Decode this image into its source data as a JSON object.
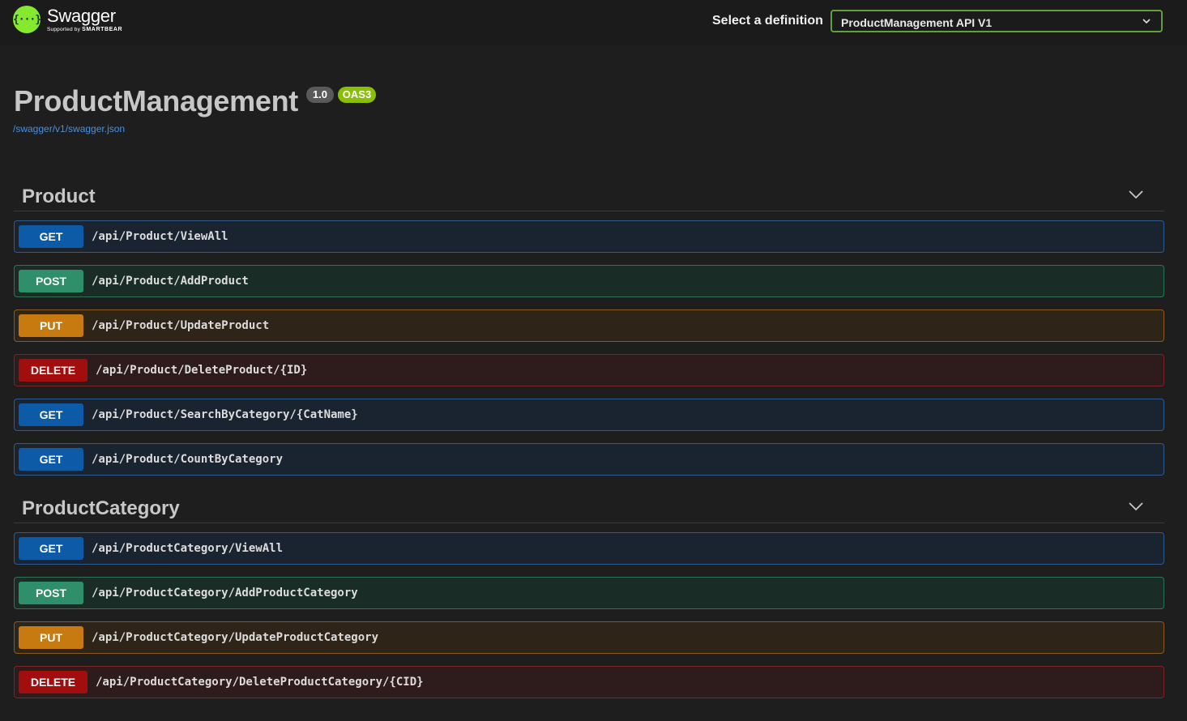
{
  "header": {
    "logo_name": "Swagger",
    "logo_sub_prefix": "Supported by",
    "logo_sub_brand": "SMARTBEAR",
    "select_label": "Select a definition",
    "selected_definition": "ProductManagement API V1"
  },
  "info": {
    "title": "ProductManagement",
    "version": "1.0",
    "oas": "OAS3",
    "spec_url": "/swagger/v1/swagger.json"
  },
  "sections": [
    {
      "name": "Product",
      "operations": [
        {
          "method": "GET",
          "path": "/api/Product/ViewAll"
        },
        {
          "method": "POST",
          "path": "/api/Product/AddProduct"
        },
        {
          "method": "PUT",
          "path": "/api/Product/UpdateProduct"
        },
        {
          "method": "DELETE",
          "path": "/api/Product/DeleteProduct/{ID}"
        },
        {
          "method": "GET",
          "path": "/api/Product/SearchByCategory/{CatName}"
        },
        {
          "method": "GET",
          "path": "/api/Product/CountByCategory"
        }
      ]
    },
    {
      "name": "ProductCategory",
      "operations": [
        {
          "method": "GET",
          "path": "/api/ProductCategory/ViewAll"
        },
        {
          "method": "POST",
          "path": "/api/ProductCategory/AddProductCategory"
        },
        {
          "method": "PUT",
          "path": "/api/ProductCategory/UpdateProductCategory"
        },
        {
          "method": "DELETE",
          "path": "/api/ProductCategory/DeleteProductCategory/{CID}"
        }
      ]
    }
  ],
  "colors": {
    "get": "#0d5aa7",
    "post": "#2f8f6b",
    "put": "#c67a10",
    "delete": "#a20e0e",
    "brand": "#85ea2d"
  }
}
